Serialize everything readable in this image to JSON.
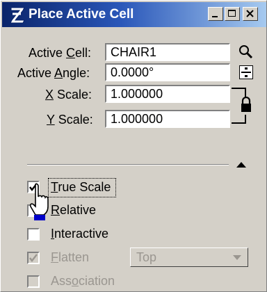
{
  "window": {
    "title": "Place Active Cell",
    "icon": "microstation-logo-icon",
    "controls": [
      "minimize-icon",
      "maximize-icon",
      "close-icon"
    ]
  },
  "fields": {
    "active_cell": {
      "label_pre": "Active ",
      "label_key": "C",
      "label_post": "ell:",
      "value": "CHAIR1",
      "icon": "search-icon"
    },
    "active_angle": {
      "label_pre": "Active ",
      "label_key": "A",
      "label_post": "ngle:",
      "value": "0.0000°",
      "icon": "calculator-icon"
    },
    "x_scale": {
      "label_key": "X",
      "label_post": " Scale:",
      "value": "1.000000"
    },
    "y_scale": {
      "label_key": "Y",
      "label_post": " Scale:",
      "value": "1.000000",
      "lock_icon": "lock-icon"
    }
  },
  "options": {
    "true_scale": {
      "label_key": "T",
      "label_post": "rue Scale",
      "checked": true,
      "enabled": true
    },
    "relative": {
      "label_key": "R",
      "label_post": "elative",
      "checked": false,
      "enabled": true
    },
    "interactive": {
      "label_key": "I",
      "label_post": "nteractive",
      "checked": false,
      "enabled": true
    },
    "flatten": {
      "label_key": "F",
      "label_post": "latten",
      "checked": true,
      "enabled": false,
      "dropdown_value": "Top"
    },
    "association": {
      "label_pre": "Ass",
      "label_key": "o",
      "label_post": "ciation",
      "checked": false,
      "enabled": false
    }
  },
  "cursor": "hand-pointer-icon",
  "collapse_icon": "triangle-up-icon"
}
